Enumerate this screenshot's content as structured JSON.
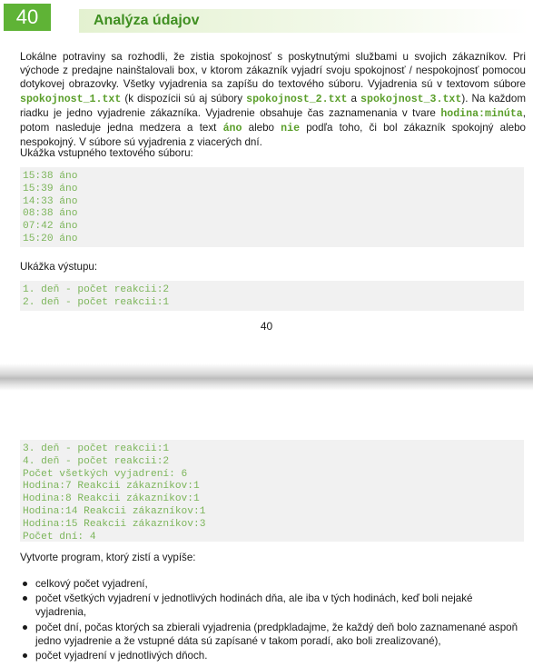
{
  "header": {
    "number": "40",
    "title": "Analýza údajov"
  },
  "intro": {
    "t1": "Lokálne potraviny sa rozhodli, že zistia spokojnosť s poskytnutými službami u svojich zákazníkov. Pri východe z predajne nainštalovali box, v ktorom zákazník vyjadrí svoju spokojnosť / nespokojnosť pomocou dotykovej obrazovky. Všetky vyjadrenia sa zapíšu do textového súboru. Vyjadrenia sú v textovom súbore ",
    "f1": "spokojnost_1.txt",
    "t2": " (k dispozícii sú aj súbory ",
    "f2": "spokojnost_2.txt",
    "t3": " a ",
    "f3": "spokojnost_3.txt",
    "t4": "). Na každom riadku je jedno vyjadrenie zákazníka. Vyjadrenie obsahuje čas zaznamenania v tvare ",
    "c1": "hodina:minúta",
    "t5": ", potom nasleduje jedna medzera a text ",
    "c2": "áno",
    "t6": " alebo ",
    "c3": "nie",
    "t7": " podľa toho, či bol zákazník spokojný alebo nespokojný. V súbore sú vyjadrenia z viacerých dní."
  },
  "sample_input_label": "Ukážka vstupného textového súboru:",
  "sample_input_lines": [
    "15:38 áno",
    "15:39 áno",
    "14:33 áno",
    "08:38 áno",
    "07:42 áno",
    "15:20 áno"
  ],
  "sample_output_label": "Ukážka výstupu:",
  "sample_output_lines_a": [
    "1. deň - počet reakcii:2",
    "2. deň - počet reakcii:1"
  ],
  "page_number": "40",
  "sample_output_lines_b": [
    "3. deň - počet reakcii:1",
    "4. deň - počet reakcii:2",
    "Počet všetkých vyjadrení: 6",
    "Hodina:7 Reakcii zákazníkov:1",
    "Hodina:8 Reakcii zákazníkov:1",
    "Hodina:14 Reakcii zákazníkov:1",
    "Hodina:15 Reakcii zákazníkov:3",
    "Počet dní: 4"
  ],
  "task_label": "Vytvorte program, ktorý zistí a vypíše:",
  "tasks": [
    "celkový počet vyjadrení,",
    "počet všetkých vyjadrení v jednotlivých hodinách dňa, ale iba v tých hodinách, keď boli nejaké vyjadrenia,",
    "počet dní, počas ktorých sa zbierali vyjadrenia (predpkladajme, že každý deň bolo zaznamenané aspoň jedno vyjadrenie a že vstupné dáta sú zapísané v takom poradí, ako boli zrealizované),",
    "počet vyjadrení v jednotlivých dňoch."
  ]
}
